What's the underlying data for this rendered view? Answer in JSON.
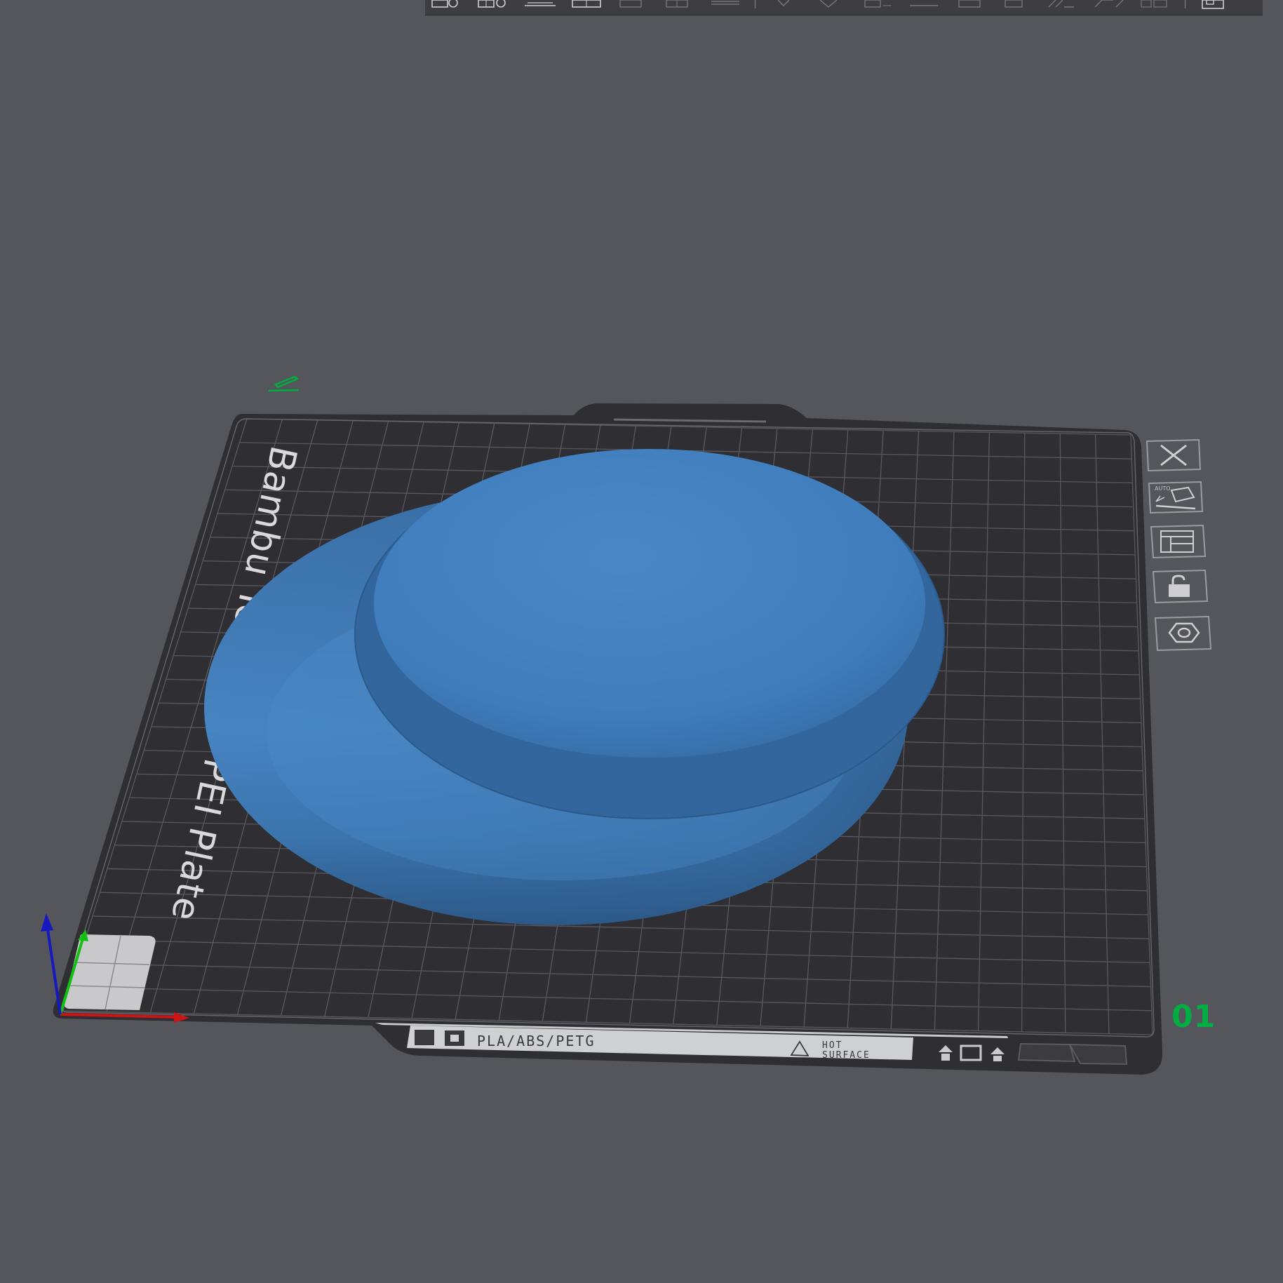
{
  "plate": {
    "name_text": "Bambu Textured PEI Plate",
    "material_text": "PLA/ABS/PETG",
    "warning_text_1": "HOT",
    "warning_text_2": "SURFACE",
    "auto_label": "AUTO",
    "index_label": "01"
  },
  "toolbar": {
    "buttons": [
      {
        "icon": "add-object-icon"
      },
      {
        "icon": "add-plate-icon"
      },
      {
        "icon": "auto-orient-icon"
      },
      {
        "icon": "arrange-icon"
      },
      {
        "icon": "split-objects-icon"
      },
      {
        "icon": "split-parts-icon"
      },
      {
        "icon": "layer-editing-icon"
      },
      {
        "icon": "move-icon"
      },
      {
        "icon": "rotate-icon"
      },
      {
        "icon": "scale-icon"
      },
      {
        "icon": "lay-on-face-icon"
      },
      {
        "icon": "cut-icon"
      },
      {
        "icon": "support-paint-icon"
      },
      {
        "icon": "seam-paint-icon"
      },
      {
        "icon": "color-paint-icon"
      },
      {
        "icon": "view-icon"
      }
    ]
  },
  "side_tools": [
    {
      "icon": "close-plate-icon"
    },
    {
      "icon": "auto-orient-plate-icon"
    },
    {
      "icon": "arrange-plate-icon"
    },
    {
      "icon": "lock-plate-icon"
    },
    {
      "icon": "plate-settings-icon"
    }
  ],
  "colors": {
    "background": "#55555c",
    "plate": "#2e2e33",
    "grid": "#55555a",
    "object": "#4480be",
    "accent": "#00ae42",
    "axis_x": "#d01010",
    "axis_y": "#10c010",
    "axis_z": "#1010c0"
  }
}
